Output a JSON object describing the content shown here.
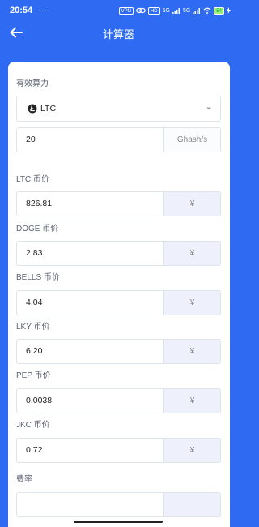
{
  "status_bar": {
    "time": "20:54",
    "dots": "···",
    "vpn_label": "VPN",
    "hd_label": "HD",
    "network_1": "5G",
    "network_2": "5G",
    "battery": "54"
  },
  "header": {
    "title": "计算器"
  },
  "form": {
    "hashrate_label": "有效算力",
    "coin_select": {
      "value": "LTC",
      "icon": "litecoin-icon"
    },
    "hashrate": {
      "value": "20",
      "unit": "Ghash/s"
    },
    "prices": [
      {
        "label": "LTC 币价",
        "value": "826.81",
        "unit": "¥"
      },
      {
        "label": "DOGE 币价",
        "value": "2.83",
        "unit": "¥"
      },
      {
        "label": "BELLS 币价",
        "value": "4.04",
        "unit": "¥"
      },
      {
        "label": "LKY 币价",
        "value": "6.20",
        "unit": "¥"
      },
      {
        "label": "PEP 币价",
        "value": "0.0038",
        "unit": "¥"
      },
      {
        "label": "JKC 币价",
        "value": "0.72",
        "unit": "¥"
      }
    ],
    "fee_label": "费率"
  },
  "colors": {
    "accent": "#2f6bf2",
    "unit_bg": "#eef1fb",
    "border": "#dfe3ea"
  }
}
